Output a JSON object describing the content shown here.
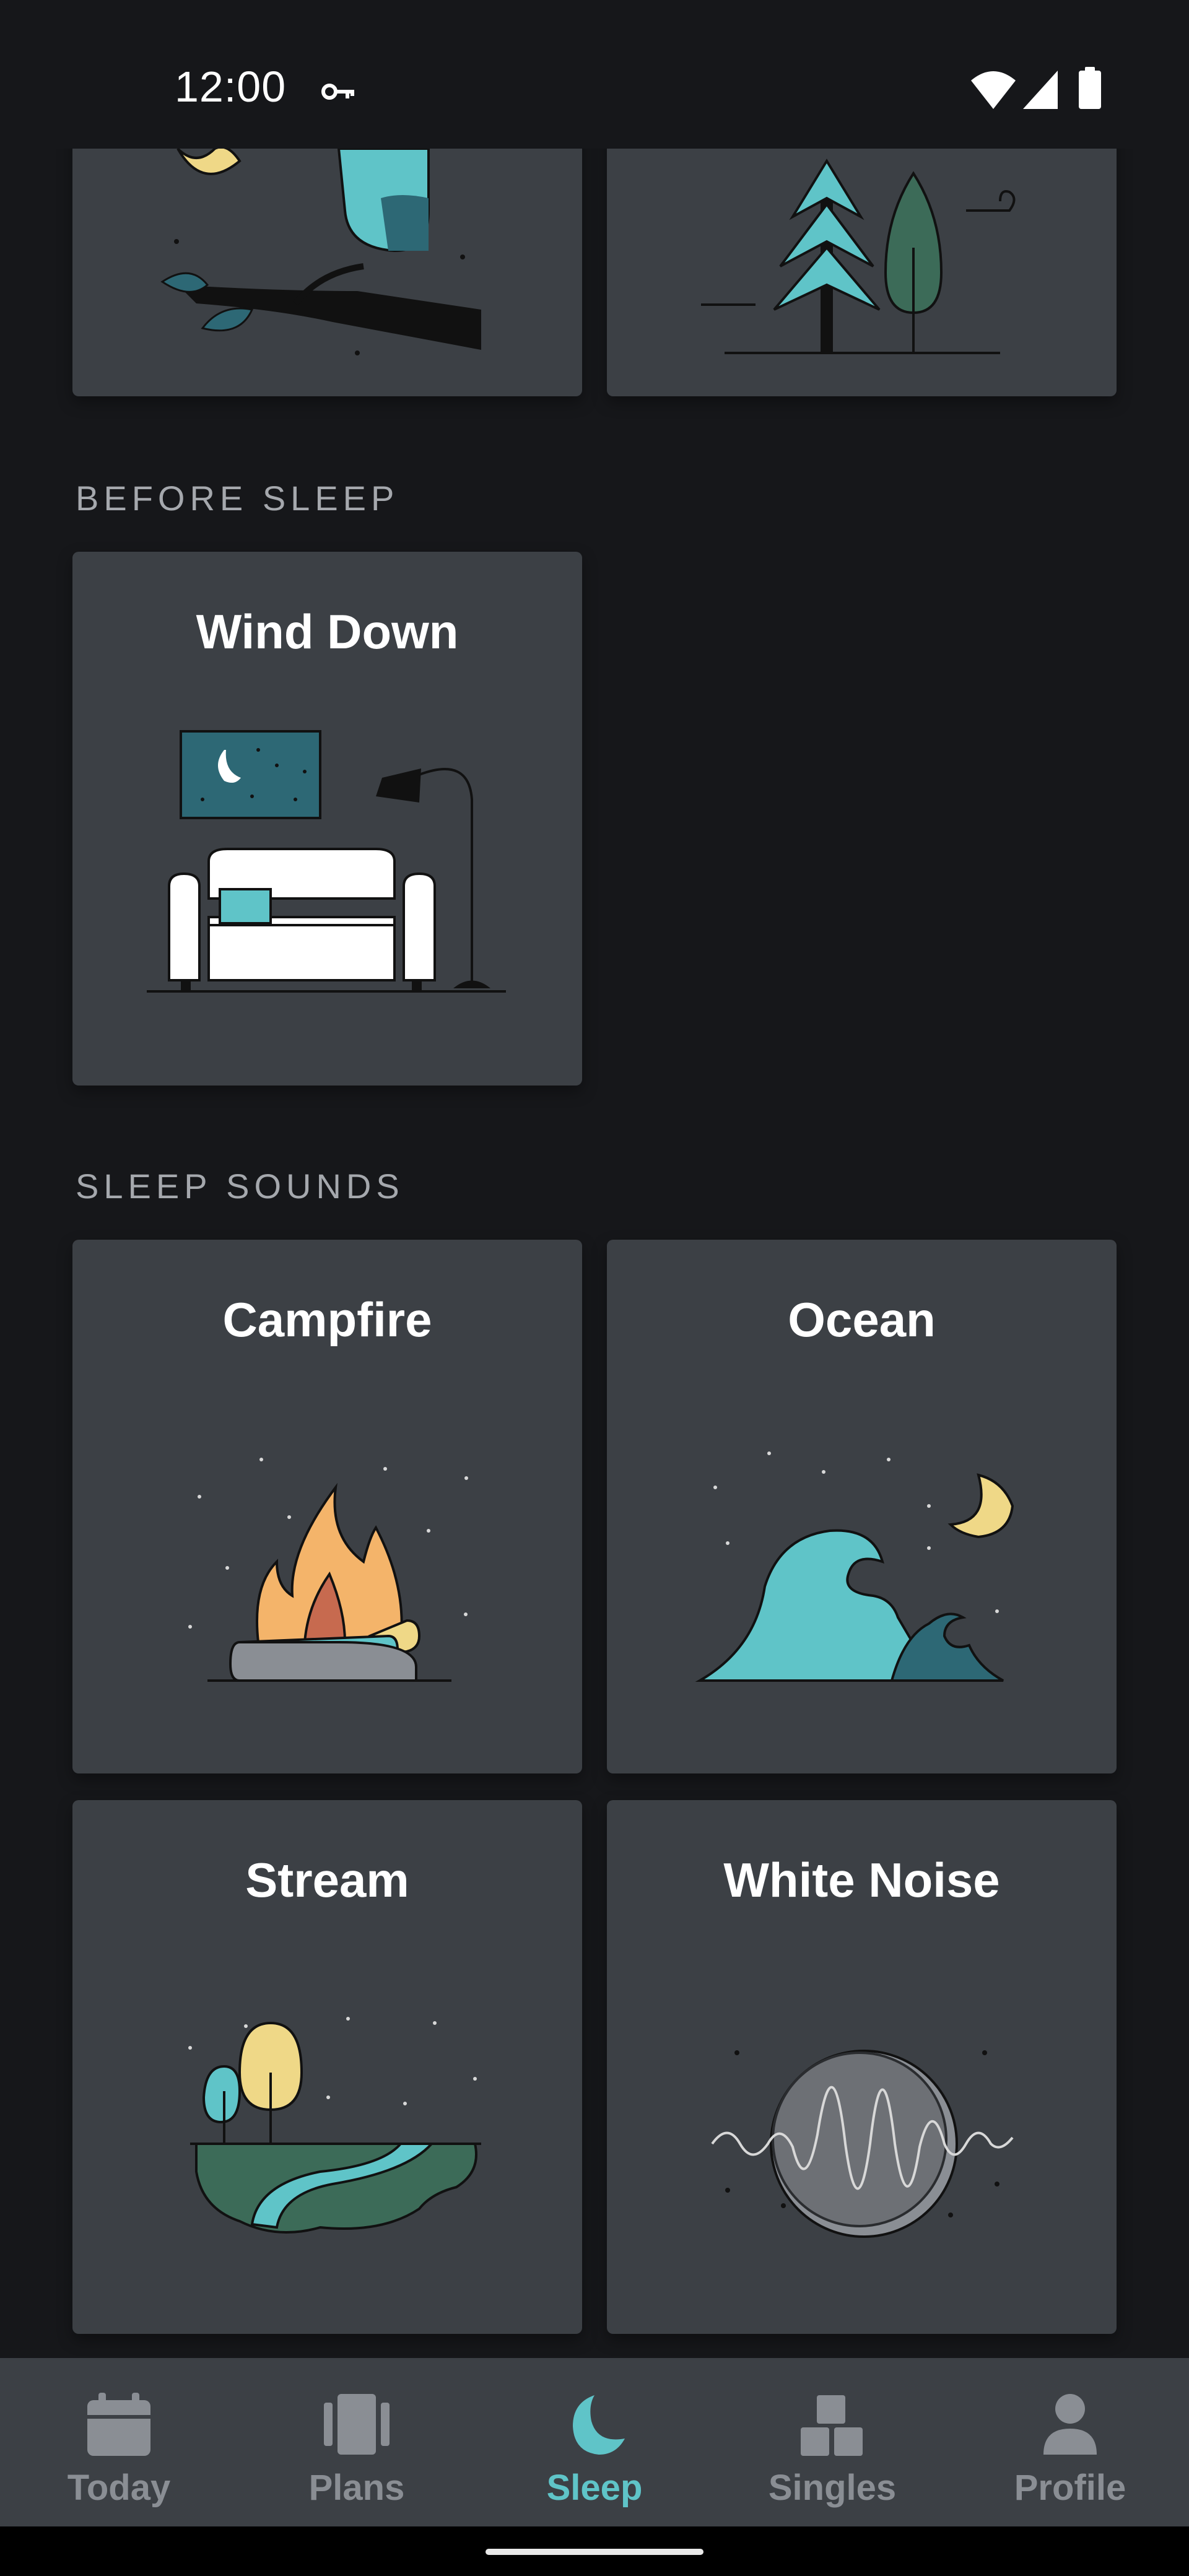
{
  "status_bar": {
    "time": "12:00",
    "icons": [
      "vpn-key-icon",
      "wifi-icon",
      "cell-signal-icon",
      "battery-icon"
    ]
  },
  "sections": {
    "before_sleep": {
      "label": "BEFORE SLEEP",
      "cards": [
        {
          "title": "Wind Down",
          "icon": "sofa-lamp-illustration"
        }
      ]
    },
    "sleep_sounds": {
      "label": "SLEEP SOUNDS",
      "cards": [
        {
          "title": "Campfire",
          "icon": "campfire-illustration"
        },
        {
          "title": "Ocean",
          "icon": "ocean-wave-illustration"
        },
        {
          "title": "Stream",
          "icon": "stream-illustration"
        },
        {
          "title": "White Noise",
          "icon": "white-noise-illustration"
        }
      ]
    }
  },
  "partial_cards": [
    {
      "icon": "owl-branch-illustration"
    },
    {
      "icon": "forest-illustration"
    }
  ],
  "bottom_nav": {
    "items": [
      {
        "label": "Today",
        "icon": "calendar-icon",
        "active": false
      },
      {
        "label": "Plans",
        "icon": "plans-icon",
        "active": false
      },
      {
        "label": "Sleep",
        "icon": "moon-icon",
        "active": true
      },
      {
        "label": "Singles",
        "icon": "blocks-icon",
        "active": false
      },
      {
        "label": "Profile",
        "icon": "person-icon",
        "active": false
      }
    ]
  },
  "colors": {
    "background": "#16171a",
    "card": "#3c4045",
    "accent": "#5fc4c8",
    "nav_inactive": "#8a8e94",
    "section_label": "#a5a8ad"
  }
}
